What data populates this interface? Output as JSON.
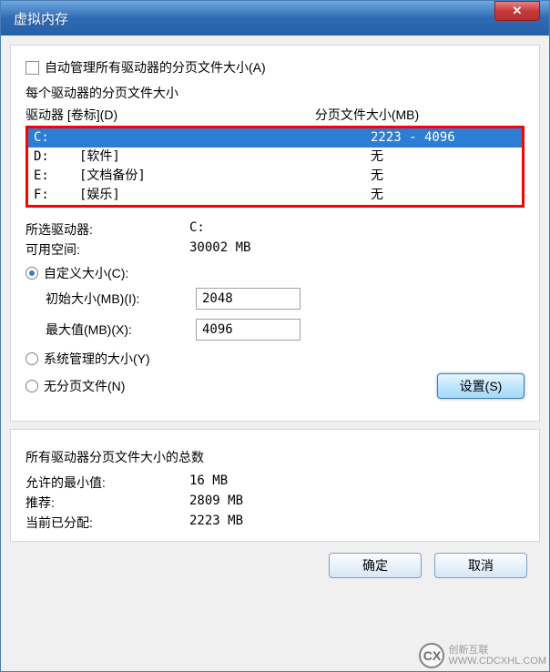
{
  "window": {
    "title": "虚拟内存"
  },
  "auto_manage": {
    "label": "自动管理所有驱动器的分页文件大小(A)",
    "checked": false
  },
  "each_drive_label": "每个驱动器的分页文件大小",
  "columns": {
    "drive": "驱动器  [卷标](D)",
    "pagefile": "分页文件大小(MB)"
  },
  "drives": [
    {
      "letter": "C:",
      "label": "",
      "pagefile": "2223 - 4096",
      "selected": true
    },
    {
      "letter": "D:",
      "label": "[软件]",
      "pagefile": "无",
      "selected": false
    },
    {
      "letter": "E:",
      "label": "[文档备份]",
      "pagefile": "无",
      "selected": false
    },
    {
      "letter": "F:",
      "label": "[娱乐]",
      "pagefile": "无",
      "selected": false
    }
  ],
  "selected_info": {
    "drive_label": "所选驱动器:",
    "drive_value": "C:",
    "space_label": "可用空间:",
    "space_value": "30002 MB"
  },
  "size_options": {
    "custom_label": "自定义大小(C):",
    "initial_label": "初始大小(MB)(I):",
    "initial_value": "2048",
    "max_label": "最大值(MB)(X):",
    "max_value": "4096",
    "system_label": "系统管理的大小(Y)",
    "none_label": "无分页文件(N)",
    "selected": "custom"
  },
  "set_button": "设置(S)",
  "totals": {
    "heading": "所有驱动器分页文件大小的总数",
    "min_label": "允许的最小值:",
    "min_value": "16 MB",
    "rec_label": "推荐:",
    "rec_value": "2809 MB",
    "alloc_label": "当前已分配:",
    "alloc_value": "2223 MB"
  },
  "buttons": {
    "ok": "确定",
    "cancel": "取消"
  },
  "watermark": {
    "logo": "CX",
    "text_top": "创新互联",
    "text_bottom": "WWW.CDCXHL.COM"
  }
}
